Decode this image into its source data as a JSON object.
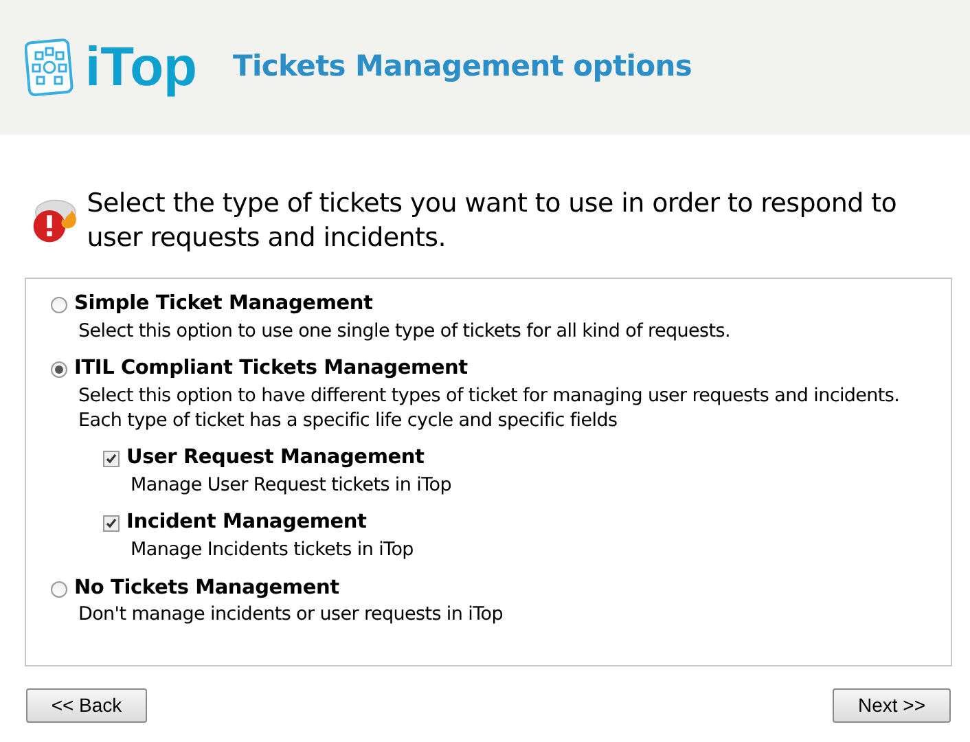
{
  "header": {
    "logo_text": "iTop",
    "title": "Tickets Management options"
  },
  "intro": "Select the type of tickets you want to use in order to respond to user requests and incidents.",
  "options": [
    {
      "label": "Simple Ticket Management",
      "description": "Select this option to use one single type of tickets for all kind of requests.",
      "selected": false
    },
    {
      "label": "ITIL Compliant Tickets Management",
      "description": "Select this option to have different types of ticket for managing user requests and incidents.\nEach type of ticket has a specific life cycle and specific fields",
      "selected": true,
      "children": [
        {
          "label": "User Request Management",
          "description": "Manage User Request tickets in iTop",
          "checked": true
        },
        {
          "label": "Incident Management",
          "description": "Manage Incidents tickets in iTop",
          "checked": true
        }
      ]
    },
    {
      "label": "No Tickets Management",
      "description": "Don't manage incidents or user requests in iTop",
      "selected": false
    }
  ],
  "buttons": {
    "back": "<< Back",
    "next": "Next >>"
  }
}
